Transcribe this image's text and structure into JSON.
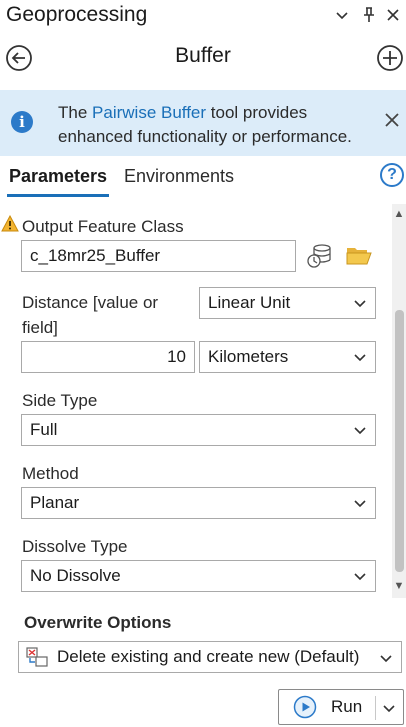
{
  "pane": {
    "title": "Geoprocessing"
  },
  "tool": {
    "title": "Buffer"
  },
  "banner": {
    "text_before": "The ",
    "link": "Pairwise Buffer",
    "text_after": " tool provides enhanced functionality or performance."
  },
  "tabs": [
    {
      "label": "Parameters",
      "active": true
    },
    {
      "label": "Environments",
      "active": false
    }
  ],
  "parameters": {
    "output_feature_class": {
      "label": "Output Feature Class",
      "value": "c_18mr25_Buffer"
    },
    "distance": {
      "label": "Distance [value or field]",
      "type_value": "Linear Unit",
      "number_value": "10",
      "unit_value": "Kilometers"
    },
    "side_type": {
      "label": "Side Type",
      "value": "Full"
    },
    "method": {
      "label": "Method",
      "value": "Planar"
    },
    "dissolve_type": {
      "label": "Dissolve Type",
      "value": "No Dissolve"
    }
  },
  "overwrite": {
    "title": "Overwrite Options",
    "value": "Delete existing and create new (Default)"
  },
  "run": {
    "label": "Run"
  },
  "colors": {
    "accent": "#1a6fb8",
    "banner_bg": "#dcecf9",
    "warning": "#e8a317"
  },
  "icons": [
    "chevron-down-icon",
    "pin-icon",
    "close-icon",
    "back-arrow-icon",
    "add-icon",
    "info-icon",
    "help-icon",
    "warning-icon",
    "dataset-options-icon",
    "folder-icon",
    "overwrite-icon",
    "play-icon"
  ]
}
